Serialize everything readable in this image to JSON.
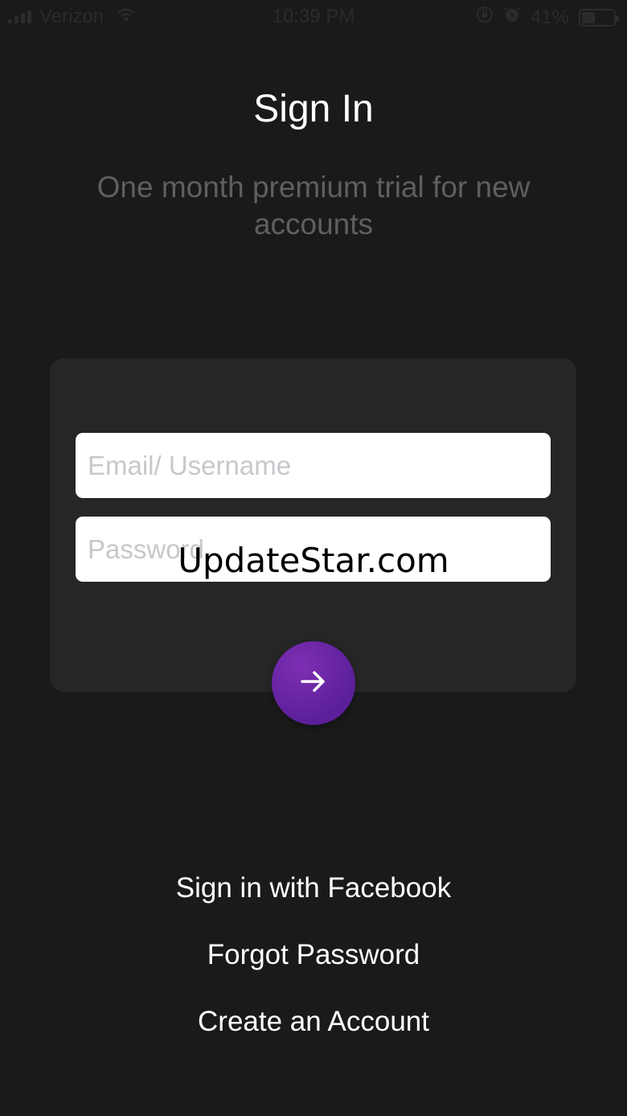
{
  "status_bar": {
    "carrier": "Verizon",
    "time": "10:39 PM",
    "battery": "41%",
    "battery_level": 0.41,
    "icons": [
      "signal-icon",
      "wifi-icon",
      "orientation-lock-icon",
      "alarm-icon",
      "battery-icon"
    ]
  },
  "header": {
    "title": "Sign In",
    "subtitle": "One month premium trial for new accounts"
  },
  "form": {
    "email_placeholder": "Email/ Username",
    "email_value": "",
    "password_placeholder": "Password",
    "password_value": "",
    "submit_icon": "arrow-right-icon"
  },
  "watermark": "UpdateStar.com",
  "links": {
    "facebook": "Sign in with Facebook",
    "forgot": "Forgot Password",
    "create": "Create an Account"
  },
  "colors": {
    "background": "#1a1a1b",
    "card": "#262627",
    "accent": "#6a25a8",
    "subtitle": "#5f5f60"
  }
}
